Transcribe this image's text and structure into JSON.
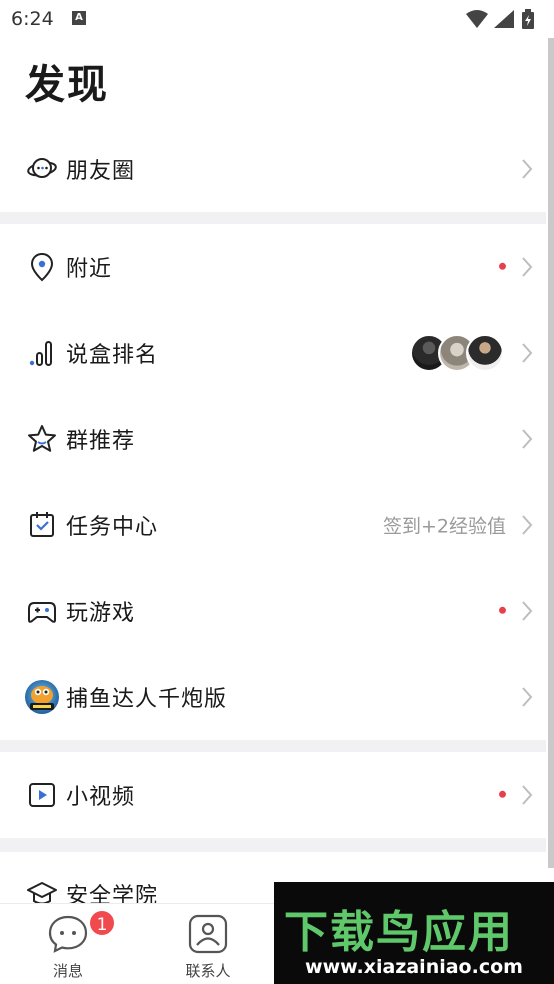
{
  "status_bar": {
    "time": "6:24",
    "notification_icon_text": "A",
    "icons": [
      "wifi-icon",
      "signal-icon",
      "battery-charging-icon"
    ]
  },
  "page": {
    "title": "发现"
  },
  "menu": {
    "moments": {
      "label": "朋友圈",
      "icon": "planet-chat-icon"
    },
    "nearby": {
      "label": "附近",
      "icon": "location-pin-icon",
      "has_red_dot": true
    },
    "ranking": {
      "label": "说盒排名",
      "icon": "bar-ranking-icon",
      "avatar_count": 3
    },
    "group_recommend": {
      "label": "群推荐",
      "icon": "star-icon"
    },
    "task_center": {
      "label": "任务中心",
      "icon": "calendar-check-icon",
      "hint": "签到+2经验值"
    },
    "games": {
      "label": "玩游戏",
      "icon": "gamepad-icon",
      "has_red_dot": true
    },
    "fishing_game": {
      "label": "捕鱼达人千炮版",
      "icon": "fishing-game-app-icon"
    },
    "short_video": {
      "label": "小视频",
      "icon": "video-play-icon",
      "has_red_dot": true
    },
    "security_academy": {
      "label": "安全学院",
      "icon": "graduation-cap-icon"
    }
  },
  "bottom_nav": {
    "messages": {
      "label": "消息",
      "badge": "1",
      "icon": "chat-bubble-icon"
    },
    "contacts": {
      "label": "联系人",
      "icon": "contact-person-icon"
    }
  },
  "watermark": {
    "title": "下载鸟应用",
    "url": "www.xiazainiao.com"
  },
  "colors": {
    "accent": "#3b6fd6",
    "red_dot": "#e8414e",
    "divider": "#f1f1f3",
    "watermark_green": "#5fc86a"
  }
}
